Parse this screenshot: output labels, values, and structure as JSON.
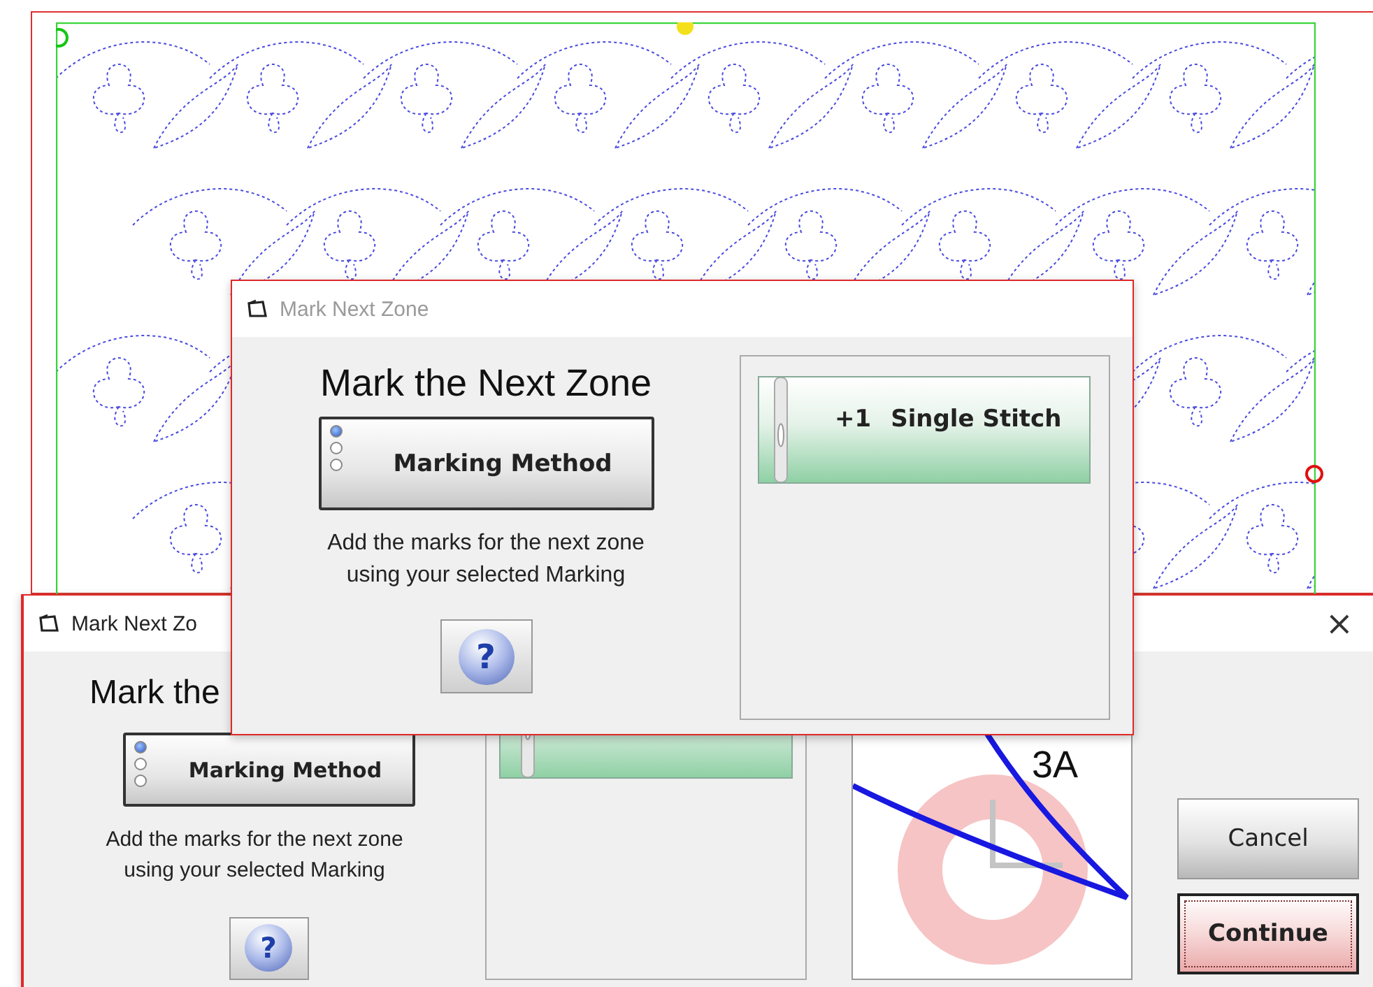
{
  "back_dialog": {
    "title": "Mark Next Zo",
    "close": "×",
    "heading": "Mark the",
    "method_button": {
      "label": "Marking Method",
      "options": [
        {
          "selected": true
        },
        {
          "selected": false
        },
        {
          "selected": false
        }
      ]
    },
    "description": "Add the marks for the next zone\nusing your selected Marking",
    "help": "?",
    "preview_label": "3A",
    "buttons": [
      {
        "label": "Cancel",
        "default": false
      },
      {
        "label": "Continue",
        "default": true
      }
    ]
  },
  "front_dialog": {
    "title": "Mark Next Zone",
    "heading": "Mark the Next Zone",
    "method_button": {
      "label": "Marking Method",
      "options": [
        {
          "selected": true
        },
        {
          "selected": false
        },
        {
          "selected": false
        }
      ]
    },
    "description": "Add the marks for the next zone\nusing your selected Marking",
    "help": "?",
    "stitch_button": {
      "count": "+1",
      "label": "Single Stitch"
    }
  }
}
